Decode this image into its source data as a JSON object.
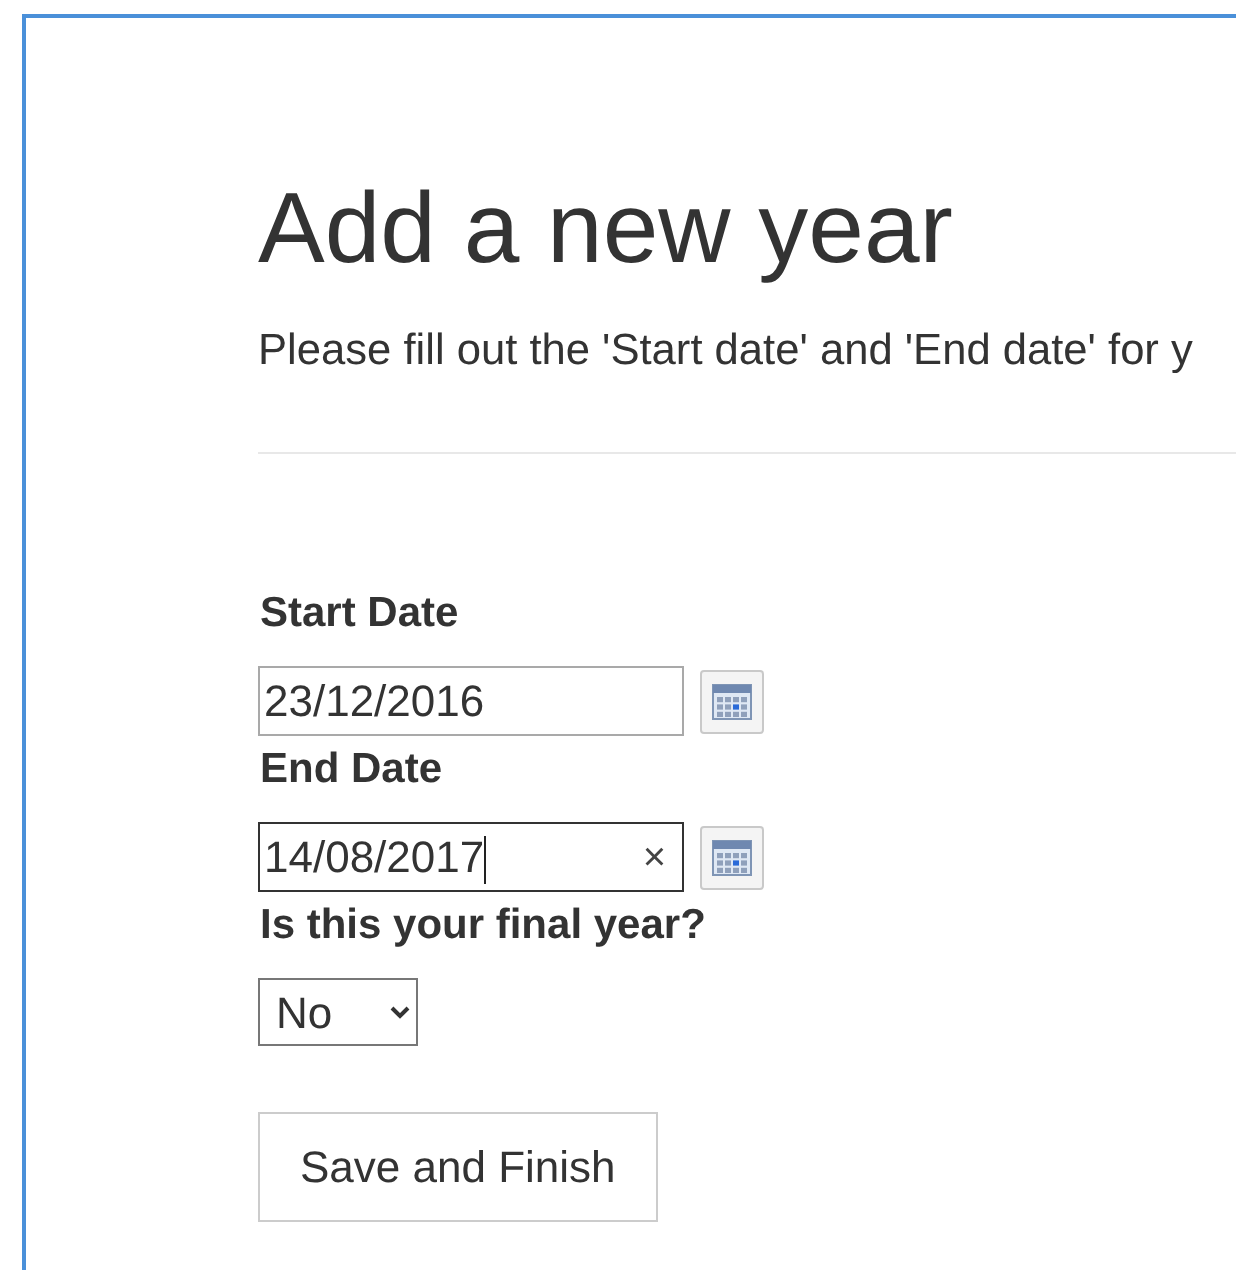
{
  "heading": "Add a new year",
  "description": "Please fill out the 'Start date' and 'End date' for y",
  "fields": [
    {
      "kind": "date",
      "label": "Start Date",
      "value": "23/12/2016",
      "focused": false
    },
    {
      "kind": "date",
      "label": "End Date",
      "value": "14/08/2017",
      "focused": true,
      "clear_icon": "×"
    },
    {
      "kind": "select",
      "label": "Is this your final year?",
      "value": "No"
    }
  ],
  "buttons": [
    "Save and Finish"
  ]
}
